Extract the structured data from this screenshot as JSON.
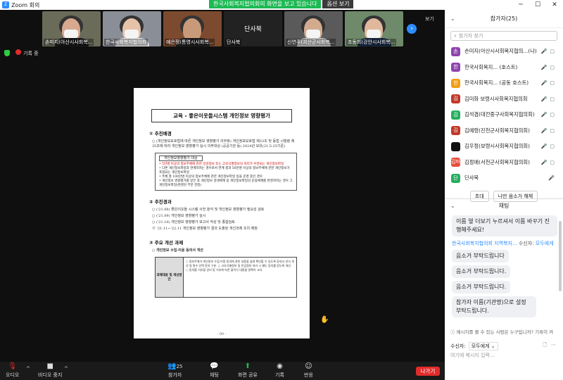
{
  "window": {
    "title": "Zoom 회의",
    "minimize": "─",
    "maximize": "☐",
    "close": "✕"
  },
  "share_banner": {
    "message": "한국사회복지협의회의 화면을 보고 있습니다",
    "options": "옵션 보기"
  },
  "videos": [
    {
      "name": "손미지(아산시사회복...",
      "skin": "#d8a98e",
      "shirt": "#1a1a1a",
      "bg": "#6b6b5a",
      "mask": true
    },
    {
      "name": "한국사회복지협의회",
      "skin": "#e6c2a8",
      "shirt": "#e9e9e9",
      "bg": "#8a8e96",
      "mask": true
    },
    {
      "name": "예은쟁(통영시사회복...",
      "skin": "#c99a7a",
      "shirt": "#222",
      "bg": "#7c4a2e",
      "mask": false
    },
    {
      "name": "단사북",
      "blank": true
    },
    {
      "name": "신연주(괴산군사회복...",
      "skin": "#d2ab8f",
      "shirt": "#ccc",
      "bg": "#5a5a5a",
      "mask": true
    },
    {
      "name": "조동희(강안시사회복...",
      "skin": "#e0b89c",
      "shirt": "#1c2d4a",
      "bg": "#6f8a6a",
      "mask": true
    }
  ],
  "view_label": "보기",
  "recording_label": "기록 중",
  "document": {
    "title": "교육 - 좋은이웃들시스템 개인정보 영향평가",
    "section1": "① 추진배경",
    "s1_text": "○ (개인정보보호법에 따른 개인정보 영향평가 의무화) 개인정보보호법 제33조 및 동법 시행령 제35조에 따라 개인정보 영향평가 실시 의무대상 (공공기관 등) 2024년 보유(21.5.25기준)",
    "box_title": "개인정보영향평가 대상",
    "box_lines": [
      "• 5만명 이상의 정보주체에 관한 민감정보 또는 고유식별정보의 처리가 수반되는 개인정보파일",
      "• 다른 개인정보파일과 연계하려는 경우로서 연계 결과 50만명 이상의 정보주체에 관한 개인정보가 포함되는 개인정보파일",
      "• 주체 총 100만명 이상의 정보주체에 관한 개인정보파일 등을 운영 중인 경우",
      "• 개인정보 영향평가를 받은 후 개인정보 검색체계 등 개인정보파일의 운용체계를 변경하려는 경우 그 개인정보파일(변경된 부분 한정)"
    ],
    "section2": "② 추진경과",
    "s2_lines": [
      "○ ('21.08) 좋은이웃들 시스템 사전 분석 및 개인정보 영향평가 필요성 검토",
      "○ ('21.09) 개인정보 영향평가 실시",
      "○ ('21.10) 개인정보 영향평가 보고서 작성 및 종합검토",
      "※ '21.11~'22.11 개인정보 영향평가 결과 도출된 개선과제 조치 예정"
    ],
    "section3": "③ 주요 개선 과제",
    "s3_sub": "○ 개인정보 수집·이용 동의서 개선",
    "tbl_head": "과제대응 및 개선방안",
    "tbl_text": "○ 정보주체가 개인정보 수집·이용 동의에 관한 내용을 쉽게 확인할 수 있도록 동의서 양식 개선 및 필수·선택 동의 구분. ○ 고유식별정보 및 민감정보 처리 시 별도 동의를 받도록 개선. ○ 동의를 거부할 권리 및 거부에 따른 불이익 내용을 명확히 고지.",
    "page": "- 00 -"
  },
  "toolbar": {
    "audio": "오디오",
    "video": "비디오 중지",
    "participants": "참가자",
    "participants_count": "25",
    "chat": "채팅",
    "share": "화면 공유",
    "record": "기록",
    "reaction": "반응",
    "leave": "나가기"
  },
  "participants_panel": {
    "title": "참가자(25)",
    "search_placeholder": "참가자 찾기",
    "list": [
      {
        "initial": "손",
        "color": "#8e44ad",
        "name": "손미지(아산시사회복지협의...(나)"
      },
      {
        "initial": "한",
        "color": "#8e44ad",
        "name": "한국사회복지...  (호스트)"
      },
      {
        "initial": "한",
        "color": "#f39c12",
        "name": "한국사회복지...  (공동 호스트)"
      },
      {
        "initial": "김",
        "color": "#c0392b",
        "name": "김미화 보령시사회복지협의회"
      },
      {
        "initial": "김",
        "color": "#27ae60",
        "name": "김석겸(대전중구사회복지협의회)"
      },
      {
        "initial": "김",
        "color": "#c0392b",
        "name": "김예령(진천군사회복지협의회)"
      },
      {
        "initial": "",
        "color": "#111",
        "name": "김우정(보령시사회복지협의회)"
      },
      {
        "initial": "김마",
        "color": "#e74c3c",
        "name": "김정애(서천군사회복지협의회)"
      },
      {
        "initial": "단",
        "color": "#27ae60",
        "name": "단사북"
      }
    ],
    "invite": "초대",
    "unmute": "나만 음소거 해제"
  },
  "chat_panel": {
    "title": "채팅",
    "msg1": "이름 옆 더보기 누르셔서 이름 바꾸기 진행해주세요!",
    "sender": "한국사회복지협의회 지역복지...",
    "sender_to": "수신자:",
    "sender_target": "모두에게",
    "msgs": [
      "음소거 부탁드립니다",
      "음소거 부탁드립니다.",
      "음소거 부탁드립니다.",
      "참가자 이름(기관명)으로 설정 부탁드립니다."
    ],
    "privacy": "메시지를 볼 수 있는 사람은 누구입니까? 기록이 켜",
    "recipient_label": "수신자:",
    "recipient": "모두에게",
    "input_placeholder": "여기에 메시지 입력..."
  }
}
